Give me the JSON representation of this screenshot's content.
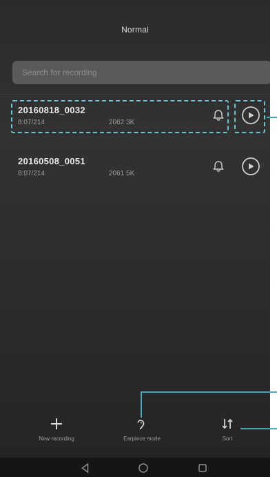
{
  "screen": {
    "title": "Normal"
  },
  "search": {
    "placeholder": "Search for recording"
  },
  "recordings": [
    {
      "name": "20160818_0032",
      "meta_left": "8:07/214",
      "meta_right": "2062 3K"
    },
    {
      "name": "20160508_0051",
      "meta_left": "8:07/214",
      "meta_right": "2061 5K"
    }
  ],
  "bottom_bar": {
    "new_recording_label": "New recording",
    "earpiece_mode_label": "Earpiece mode",
    "sort_label": "Sort"
  },
  "icons": {
    "bell": "bell-icon",
    "play": "play-icon",
    "add": "plus-icon",
    "earpiece": "ear-icon",
    "sort": "sort-icon",
    "back": "back-icon",
    "home": "home-icon",
    "recents": "recents-icon"
  },
  "colors": {
    "callout": "#6bc3cd",
    "leader": "#4aa8b3"
  }
}
